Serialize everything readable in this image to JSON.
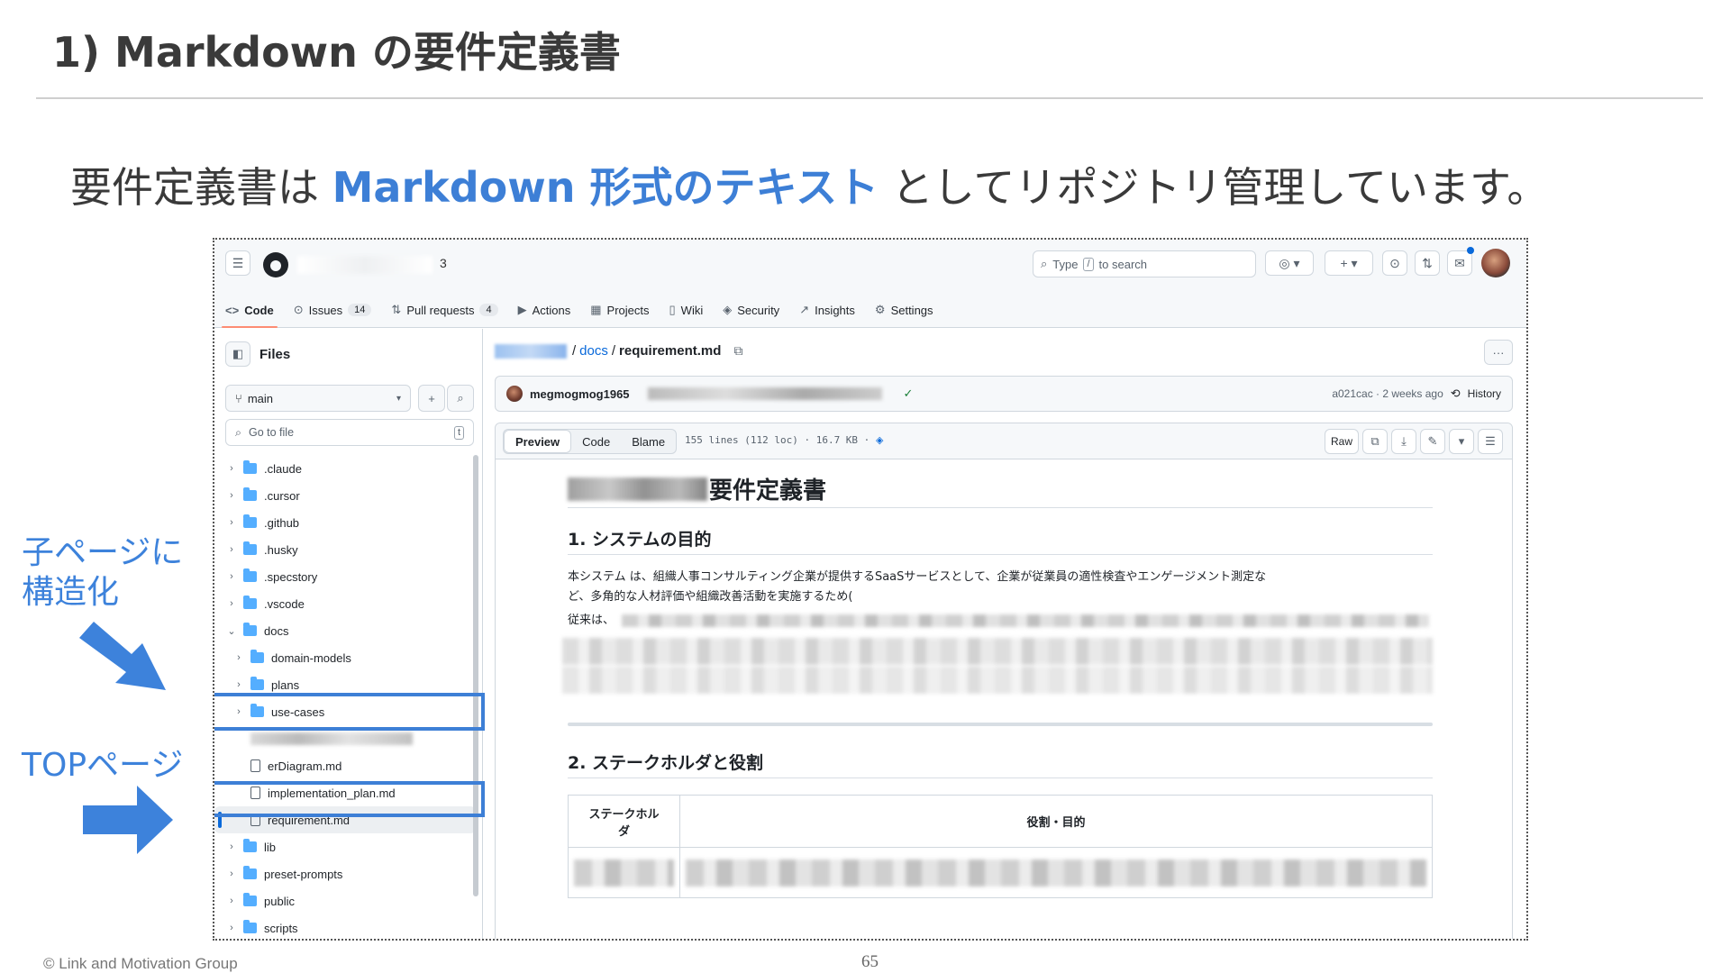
{
  "slide": {
    "title": "1) Markdown の要件定義書",
    "headline_before": "要件定義書は ",
    "headline_highlight": "Markdown 形式のテキスト",
    "headline_after": " としてリポジトリ管理しています。",
    "callout_child_line1": "子ページに",
    "callout_child_line2": "構造化",
    "callout_top": "TOPページ",
    "copyright": "© Link and Motivation Group",
    "page_number": "65",
    "accent_color": "#3d7fd6"
  },
  "github": {
    "repo_name_tail": "3",
    "search": {
      "prefix": "Type",
      "key": "/",
      "suffix": "to search"
    },
    "nav": [
      {
        "label": "Code",
        "icon": "code-icon",
        "glyph": "<>"
      },
      {
        "label": "Issues",
        "icon": "issue-icon",
        "glyph": "⊙",
        "count": "14"
      },
      {
        "label": "Pull requests",
        "icon": "pull-request-icon",
        "glyph": "⇅",
        "count": "4"
      },
      {
        "label": "Actions",
        "icon": "play-icon",
        "glyph": "▶"
      },
      {
        "label": "Projects",
        "icon": "table-icon",
        "glyph": "▦"
      },
      {
        "label": "Wiki",
        "icon": "book-icon",
        "glyph": "▯"
      },
      {
        "label": "Security",
        "icon": "shield-icon",
        "glyph": "◈"
      },
      {
        "label": "Insights",
        "icon": "graph-icon",
        "glyph": "↗"
      },
      {
        "label": "Settings",
        "icon": "gear-icon",
        "glyph": "⚙"
      }
    ],
    "sidebar": {
      "title": "Files",
      "branch": "main",
      "go_to_file": "Go to file",
      "go_to_file_key": "t",
      "tree": [
        {
          "label": ".claude",
          "type": "folder",
          "depth": 0,
          "open": false
        },
        {
          "label": ".cursor",
          "type": "folder",
          "depth": 0,
          "open": false
        },
        {
          "label": ".github",
          "type": "folder",
          "depth": 0,
          "open": false
        },
        {
          "label": ".husky",
          "type": "folder",
          "depth": 0,
          "open": false
        },
        {
          "label": ".specstory",
          "type": "folder",
          "depth": 0,
          "open": false
        },
        {
          "label": ".vscode",
          "type": "folder",
          "depth": 0,
          "open": false
        },
        {
          "label": "docs",
          "type": "folder",
          "depth": 0,
          "open": true
        },
        {
          "label": "domain-models",
          "type": "folder",
          "depth": 1,
          "open": false
        },
        {
          "label": "plans",
          "type": "folder",
          "depth": 1,
          "open": false
        },
        {
          "label": "use-cases",
          "type": "folder",
          "depth": 1,
          "open": false
        },
        {
          "label": "",
          "type": "blurred",
          "depth": 1
        },
        {
          "label": "erDiagram.md",
          "type": "file",
          "depth": 1
        },
        {
          "label": "implementation_plan.md",
          "type": "file",
          "depth": 1
        },
        {
          "label": "requirement.md",
          "type": "file",
          "depth": 1,
          "selected": true
        },
        {
          "label": "lib",
          "type": "folder",
          "depth": 0,
          "open": false
        },
        {
          "label": "preset-prompts",
          "type": "folder",
          "depth": 0,
          "open": false
        },
        {
          "label": "public",
          "type": "folder",
          "depth": 0,
          "open": false
        },
        {
          "label": "scripts",
          "type": "folder",
          "depth": 0,
          "open": false
        }
      ]
    },
    "breadcrumb": {
      "sep": "/",
      "folder": "docs",
      "file": "requirement.md"
    },
    "commit": {
      "author": "megmogmog1965",
      "meta": "a021cac · 2 weeks ago",
      "history": "History"
    },
    "file_toolbar": {
      "tabs": [
        "Preview",
        "Code",
        "Blame"
      ],
      "stats": "155 lines (112 loc) · 16.7 KB ·",
      "raw": "Raw"
    },
    "markdown": {
      "h1_suffix": "要件定義書",
      "h2_1": "1. システムの目的",
      "p1": "本システム                         は、組織人事コンサルティング企業が提供するSaaSサービスとして、企業が従業員の適性検査やエンゲージメント測定な",
      "p1b": "ど、多角的な人材評価や組織改善活動を実施するため(",
      "p2": "従来は、",
      "h2_2": "2. ステークホルダと役割",
      "table_header_1_line1": "ステークホル",
      "table_header_1_line2": "ダ",
      "table_header_2": "役割・目的"
    }
  }
}
